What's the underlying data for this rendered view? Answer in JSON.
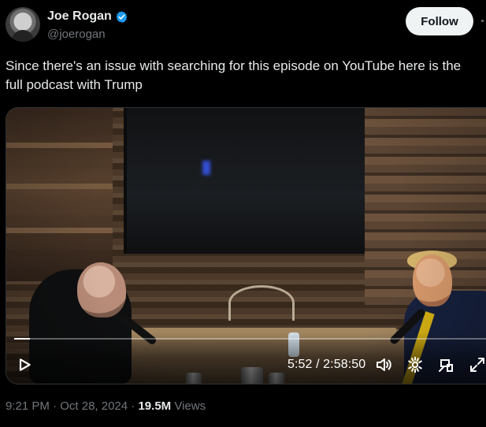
{
  "author": {
    "display_name": "Joe Rogan",
    "handle": "@joerogan",
    "verified_icon": "verified-badge-icon",
    "avatar_icon": "profile-avatar"
  },
  "actions": {
    "follow_label": "Follow"
  },
  "tweet": {
    "text": "Since there's an issue with searching for this episode on YouTube here is the full podcast with Trump"
  },
  "video": {
    "time": "5:52 / 2:58:50",
    "progress": 0.033,
    "play_icon": "play-icon",
    "volume_icon": "volume-icon",
    "settings_icon": "settings-icon",
    "pip_icon": "picture-in-picture-icon",
    "fullscreen_icon": "fullscreen-icon"
  },
  "footer": {
    "time": "9:21 PM",
    "date": "Oct 28, 2024",
    "separator": " · ",
    "views_count": "19.5M",
    "views_label": "Views"
  },
  "colors": {
    "background": "#000000",
    "text": "#e7e9ea",
    "muted": "#71767b",
    "verified": "#1d9bf0",
    "button": "#eff3f4"
  }
}
